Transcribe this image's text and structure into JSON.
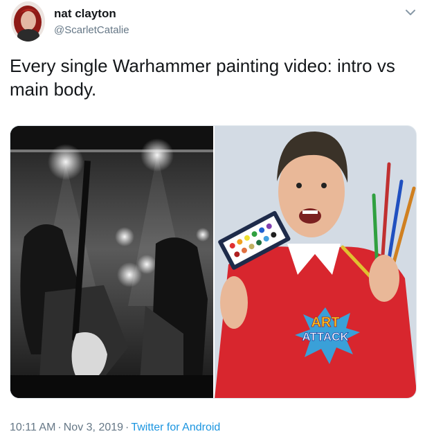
{
  "author": {
    "name": "nat clayton",
    "handle": "@ScarletCatalie"
  },
  "tweet": {
    "text": "Every single Warhammer painting video: intro vs main body."
  },
  "media": {
    "logo_line1": "ART",
    "logo_line2": "ATTACK"
  },
  "meta": {
    "time": "10:11 AM",
    "separator": "·",
    "date": "Nov 3, 2019",
    "source": "Twitter for Android"
  },
  "colors": {
    "link": "#1b95e0",
    "secondary_text": "#657786",
    "primary_text": "#14171a",
    "sweater_red": "#d8262e"
  },
  "icons": {
    "menu": "chevron-down-icon"
  }
}
